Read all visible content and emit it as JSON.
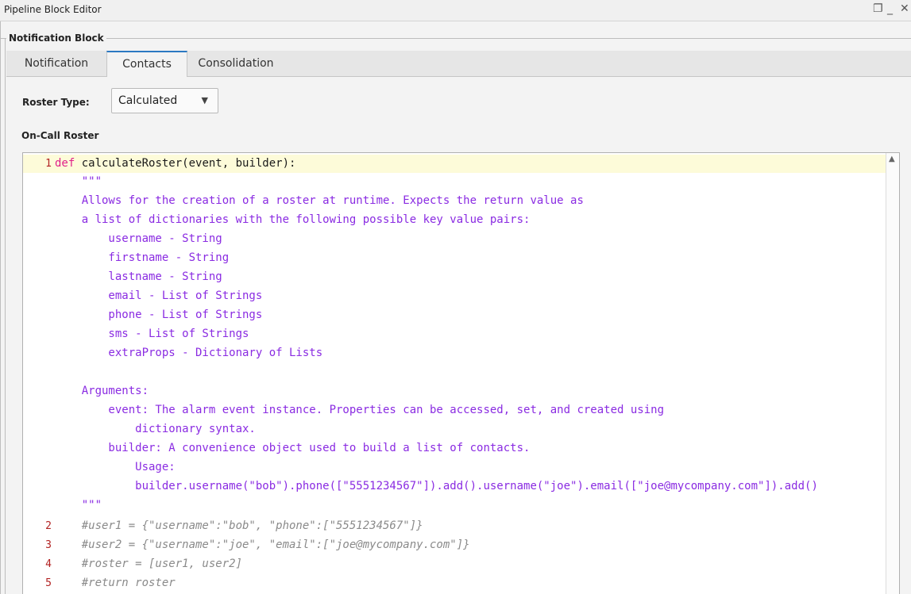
{
  "window": {
    "title": "Pipeline Block Editor",
    "restore_icon": "restore-icon",
    "minimize_icon": "minimize-icon",
    "close_icon": "close-icon"
  },
  "group": {
    "title": "Notification Block"
  },
  "tabs": [
    {
      "label": "Notification",
      "active": false
    },
    {
      "label": "Contacts",
      "active": true
    },
    {
      "label": "Consolidation",
      "active": false
    }
  ],
  "roster_type": {
    "label": "Roster Type:",
    "value": "Calculated"
  },
  "on_call": {
    "label": "On-Call Roster"
  },
  "colors": {
    "accent": "#2b79c2",
    "keyword": "#e0218a",
    "docstring": "#8a2be2",
    "comment": "#8a8a8a",
    "line_number": "#b22222",
    "current_line": "#fdfbd9"
  },
  "code": {
    "line1": {
      "num": "1",
      "kw": "def",
      "rest": " calculateRoster(event, builder):"
    },
    "doc": [
      "    \"\"\"",
      "    Allows for the creation of a roster at runtime. Expects the return value as",
      "    a list of dictionaries with the following possible key value pairs:",
      "        username - String",
      "        firstname - String",
      "        lastname - String",
      "        email - List of Strings",
      "        phone - List of Strings",
      "        sms - List of Strings",
      "        extraProps - Dictionary of Lists",
      "",
      "    Arguments:",
      "        event: The alarm event instance. Properties can be accessed, set, and created using",
      "            dictionary syntax.",
      "        builder: A convenience object used to build a list of contacts.",
      "            Usage:",
      "            builder.username(\"bob\").phone([\"5551234567\"]).add().username(\"joe\").email([\"joe@mycompany.com\"]).add()",
      "    \"\"\""
    ],
    "comments": [
      {
        "num": "2",
        "text": "    #user1 = {\"username\":\"bob\", \"phone\":[\"5551234567\"]}"
      },
      {
        "num": "3",
        "text": "    #user2 = {\"username\":\"joe\", \"email\":[\"joe@mycompany.com\"]}"
      },
      {
        "num": "4",
        "text": "    #roster = [user1, user2]"
      },
      {
        "num": "5",
        "text": "    #return roster"
      }
    ]
  }
}
